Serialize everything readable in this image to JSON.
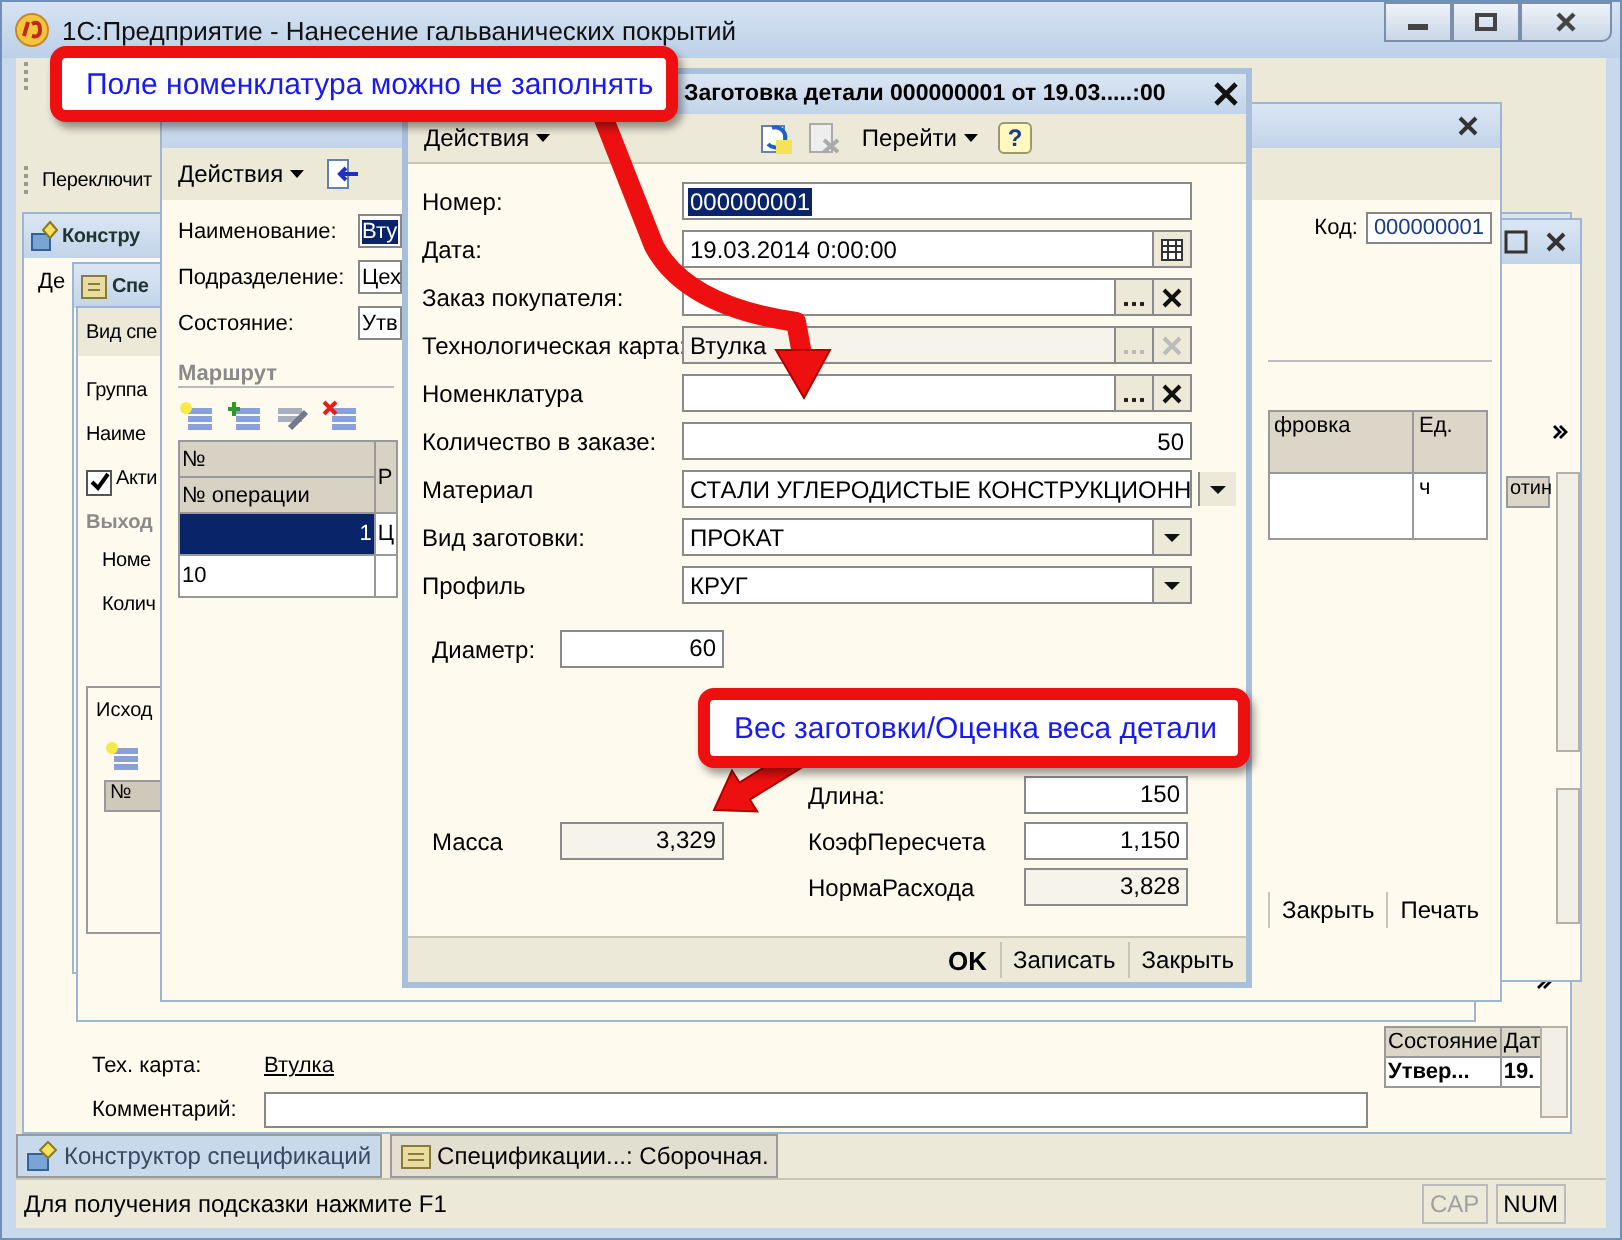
{
  "app_window": {
    "title": "1С:Предприятие - Нанесение гальванических покрытий"
  },
  "toolbar_label": "Переключит",
  "constructor_window": {
    "title": "Констру",
    "menu": "Де",
    "tech_card_label": "Тех. карта:",
    "tech_card_link": "Втулка",
    "comment_label": "Комментарий:",
    "states_table": {
      "columns": [
        "Состояние",
        "Дат"
      ],
      "rows": [
        [
          "Утвер...",
          "19."
        ]
      ]
    }
  },
  "spec_window": {
    "title": "Спе"
  },
  "spec_form": {
    "header": "Вид спе",
    "labels": [
      "Группа",
      "Наиме"
    ],
    "active": {
      "label": "Акти",
      "checked": true
    },
    "section": "Выход",
    "labels2": [
      "Номе",
      "Колич"
    ],
    "tab": "Исход",
    "table_column": "№"
  },
  "spec_card": {
    "actions": "Действия",
    "fields": [
      {
        "label": "Наименование:",
        "value": "Вту",
        "highlighted": true
      },
      {
        "label": "Подразделение:",
        "value": "Цех",
        "highlighted": false
      },
      {
        "label": "Состояние:",
        "value": "Утв",
        "highlighted": false
      }
    ],
    "route_title": "Маршрут",
    "route_table": {
      "columns": [
        "№",
        "Р"
      ],
      "subheader": "№ операции",
      "rows": [
        {
          "cells": [
            "1",
            "Ц"
          ],
          "selected": true
        },
        {
          "cells": [
            "10"
          ],
          "selected": false
        }
      ]
    },
    "code_label": "Код:",
    "code_value": "000000001",
    "ops_table": {
      "columns": [
        "фровка",
        "Ед."
      ],
      "rows": [
        [
          "",
          "ч"
        ]
      ]
    },
    "buttons": [
      "Закрыть",
      "Печать"
    ]
  },
  "side_window": {
    "column": "отин"
  },
  "dialog": {
    "title": "Заготовка детали 000000001 от 19.03.....:00",
    "actions": "Действия",
    "goto": "Перейти",
    "help": "?",
    "fields": [
      {
        "label": "Номер:",
        "kind": "text",
        "value": "000000001",
        "highlighted": true,
        "disabled": false
      },
      {
        "label": "Дата:",
        "kind": "date",
        "value": "19.03.2014  0:00:00",
        "highlighted": false,
        "disabled": false
      },
      {
        "label": "Заказ покупателя:",
        "kind": "ref",
        "highlighted": false,
        "disabled": false
      },
      {
        "label": "Технологическая карта:",
        "kind": "ref",
        "value": "Втулка",
        "highlighted": false,
        "disabled": true
      },
      {
        "label": "Номенклатура",
        "kind": "ref",
        "highlighted": false,
        "disabled": false
      },
      {
        "label": "Количество в заказе:",
        "kind": "number",
        "value": "50",
        "highlighted": false,
        "disabled": false
      },
      {
        "label": "Материал",
        "kind": "select",
        "value": "СТАЛИ УГЛЕРОДИСТЫЕ КОНСТРУКЦИОНН",
        "highlighted": false,
        "disabled": false
      },
      {
        "label": "Вид заготовки:",
        "kind": "select",
        "value": "ПРОКАТ",
        "highlighted": false,
        "disabled": false
      },
      {
        "label": "Профиль",
        "kind": "select",
        "value": "КРУГ",
        "highlighted": false,
        "disabled": false
      }
    ],
    "diameter": {
      "label": "Диаметр:",
      "value": "60",
      "readonly": false
    },
    "mass": {
      "label": "Масса",
      "value": "3,329",
      "readonly": true
    },
    "params": [
      {
        "label": "Длина:",
        "value": "150",
        "readonly": false
      },
      {
        "label": "КоэфПересчета",
        "value": "1,150",
        "readonly": false
      },
      {
        "label": "НормаРасхода",
        "value": "3,828",
        "readonly": true
      }
    ],
    "buttons": [
      {
        "label": "OK",
        "default": true
      },
      {
        "label": "Записать",
        "default": false
      },
      {
        "label": "Закрыть",
        "default": false
      }
    ]
  },
  "callouts": [
    {
      "text": "Поле номенклатура можно не заполнять"
    },
    {
      "text": "Вес заготовки/Оценка веса детали"
    }
  ],
  "taskbar": [
    {
      "label": "Конструктор спецификаций",
      "selected": true
    },
    {
      "label": "Спецификации...: Сборочная.",
      "selected": false
    }
  ],
  "status_bar": {
    "hint": "Для получения подсказки нажмите F1",
    "indicators": [
      {
        "label": "CAP",
        "on": false
      },
      {
        "label": "NUM",
        "on": true
      }
    ]
  }
}
